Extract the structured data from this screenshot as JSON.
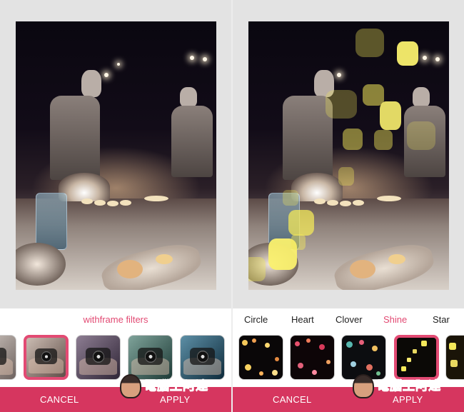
{
  "left_screen": {
    "filter_title": "withframe filters",
    "cancel_label": "CANCEL",
    "apply_label": "APPLY",
    "thumbnails": [
      {
        "name": "filter-thumb-1",
        "selected": false
      },
      {
        "name": "filter-thumb-2",
        "selected": true
      },
      {
        "name": "filter-thumb-3",
        "selected": false
      },
      {
        "name": "filter-thumb-4",
        "selected": false
      },
      {
        "name": "filter-thumb-5",
        "selected": false
      }
    ]
  },
  "right_screen": {
    "tabs": [
      {
        "label": "Circle",
        "active": false
      },
      {
        "label": "Heart",
        "active": false
      },
      {
        "label": "Clover",
        "active": false
      },
      {
        "label": "Shine",
        "active": true
      },
      {
        "label": "Star",
        "active": false
      }
    ],
    "cancel_label": "CANCEL",
    "apply_label": "APPLY"
  },
  "watermark_text": "電腦王阿達",
  "colors": {
    "accent": "#e24a73",
    "action_bar": "#d6365f",
    "canvas_bg": "#e3e3e3",
    "bokeh": "#f3e85a"
  }
}
